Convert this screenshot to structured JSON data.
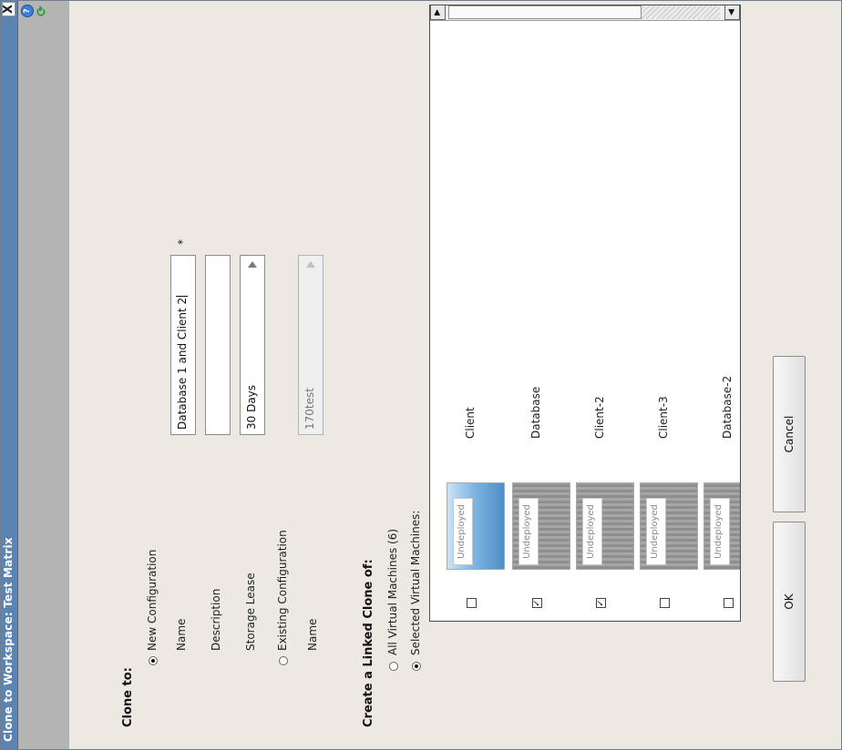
{
  "window": {
    "title": "Clone to Workspace: Test Matrix",
    "close_label": "X",
    "help_label": "?",
    "refresh_label": "⟳"
  },
  "clone_to": {
    "heading": "Clone to:",
    "new_configuration_label": "New Configuration",
    "name_label": "Name",
    "name_value": "Database 1 and Client 2",
    "required_marker": "*",
    "description_label": "Description",
    "description_value": "",
    "storage_lease_label": "Storage Lease",
    "storage_lease_value": "30 Days",
    "existing_configuration_label": "Existing Configuration",
    "existing_name_label": "Name",
    "existing_name_value": "170test",
    "selected": "new"
  },
  "linked_clone": {
    "heading": "Create a Linked Clone of:",
    "all_vms_label": "All Virtual Machines (6)",
    "selected_vms_label": "Selected Virtual Machines:",
    "selected": "selected"
  },
  "vms": [
    {
      "name": "Client",
      "status": "Undeployed",
      "checked": false
    },
    {
      "name": "Database",
      "status": "Undeployed",
      "checked": true
    },
    {
      "name": "Client-2",
      "status": "Undeployed",
      "checked": true
    },
    {
      "name": "Client-3",
      "status": "Undeployed",
      "checked": false
    },
    {
      "name": "Database-2",
      "status": "Undeployed",
      "checked": false
    }
  ],
  "scrollbar": {
    "back_arrow": "◀",
    "forward_arrow": "▶"
  },
  "buttons": {
    "ok_label": "OK",
    "cancel_label": "Cancel"
  }
}
